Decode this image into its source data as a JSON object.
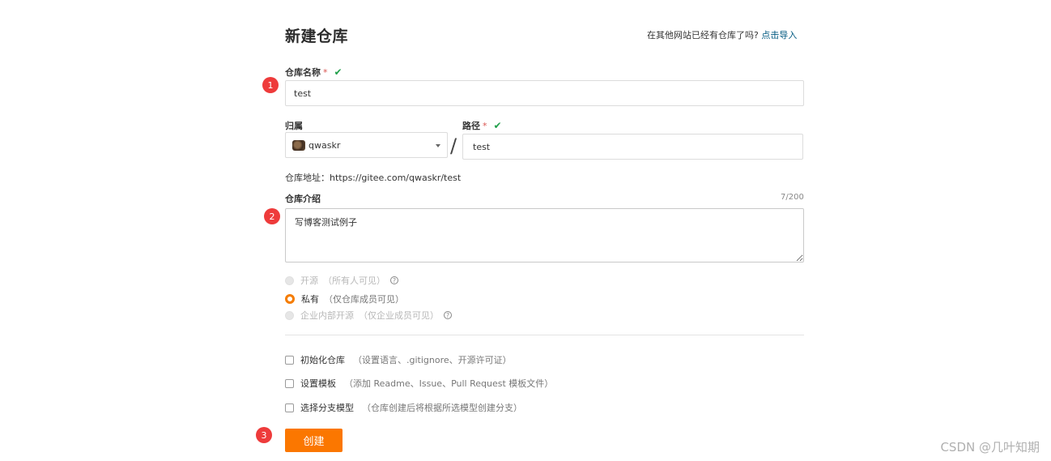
{
  "page": {
    "title": "新建仓库",
    "import_hint": "在其他网站已经有仓库了吗?",
    "import_link": "点击导入"
  },
  "badges": [
    "1",
    "2",
    "3"
  ],
  "repo_name": {
    "label": "仓库名称",
    "required_mark": "*",
    "valid_mark": "✔",
    "value": "test"
  },
  "owner": {
    "label": "归属",
    "value": "qwaskr"
  },
  "separator": "/",
  "path": {
    "label": "路径",
    "required_mark": "*",
    "valid_mark": "✔",
    "value": "test"
  },
  "address": {
    "text": "仓库地址：https://gitee.com/qwaskr/test"
  },
  "description": {
    "label": "仓库介绍",
    "counter": "7/200",
    "value": "写博客测试例子"
  },
  "visibility": {
    "options": [
      {
        "label": "开源",
        "desc": "（所有人可见）",
        "help": "?",
        "state": "disabled"
      },
      {
        "label": "私有",
        "desc": "（仅仓库成员可见）",
        "state": "selected"
      },
      {
        "label": "企业内部开源",
        "desc": "（仅企业成员可见）",
        "help": "?",
        "state": "disabled"
      }
    ]
  },
  "options": [
    {
      "label": "初始化仓库",
      "desc": "（设置语言、.gitignore、开源许可证）"
    },
    {
      "label": "设置模板",
      "desc": "（添加 Readme、Issue、Pull Request 模板文件）"
    },
    {
      "label": "选择分支模型",
      "desc": "（仓库创建后将根据所选模型创建分支）"
    }
  ],
  "create_button": "创建",
  "watermark": "CSDN @几叶知期",
  "colors": {
    "accent": "#fb7700",
    "badge": "#ee3b3b",
    "valid": "#21a04b",
    "link": "#005980"
  },
  "icons": [
    "check-icon",
    "caret-down-icon",
    "help-icon",
    "avatar"
  ]
}
